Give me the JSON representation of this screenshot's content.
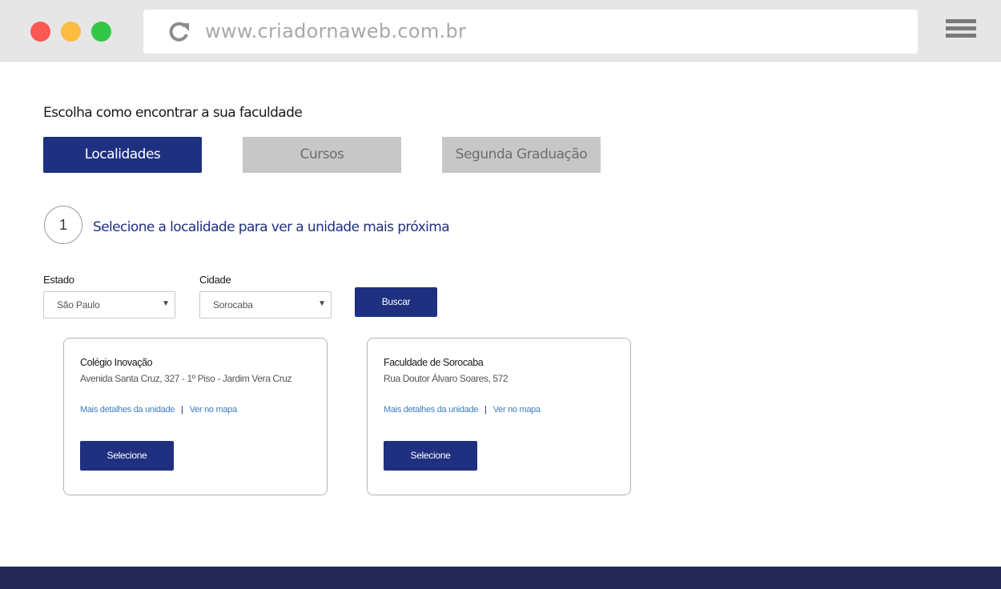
{
  "browser": {
    "url": "www.criadornaweb.com.br",
    "traffic_light_colors": [
      "#fc5753",
      "#fdbc40",
      "#33c748"
    ],
    "icons": {
      "reload": "reload-icon",
      "menu": "hamburger-menu-icon"
    }
  },
  "page": {
    "headline": "Escolha como encontrar a sua faculdade",
    "tabs": [
      {
        "label": "Localidades",
        "active": true
      },
      {
        "label": "Cursos",
        "active": false
      },
      {
        "label": "Segunda Graduação",
        "active": false
      }
    ],
    "step": {
      "number": "1",
      "text": "Selecione a localidade para ver a unidade mais próxima"
    },
    "filters": {
      "estado": {
        "label": "Estado",
        "value": "São Paulo"
      },
      "cidade": {
        "label": "Cidade",
        "value": "Sorocaba"
      },
      "search_label": "Buscar"
    },
    "results": [
      {
        "name": "Colégio Inovação",
        "address": "Avenida Santa Cruz, 327 - 1º Piso - Jardim Vera Cruz",
        "details_link": "Mais detalhes da unidade",
        "separator": "|",
        "map_link": "Ver no mapa",
        "select_label": "Selecione"
      },
      {
        "name": "Faculdade de Sorocaba",
        "address": "Rua Doutor Álvaro Soares, 572",
        "details_link": "Mais detalhes da unidade",
        "separator": "|",
        "map_link": "Ver no mapa",
        "select_label": "Selecione"
      }
    ]
  },
  "colors": {
    "brand": "#1f3080",
    "link": "#3a7ec2",
    "inactive_tab": "#c7c7c7",
    "footer": "#232856"
  }
}
